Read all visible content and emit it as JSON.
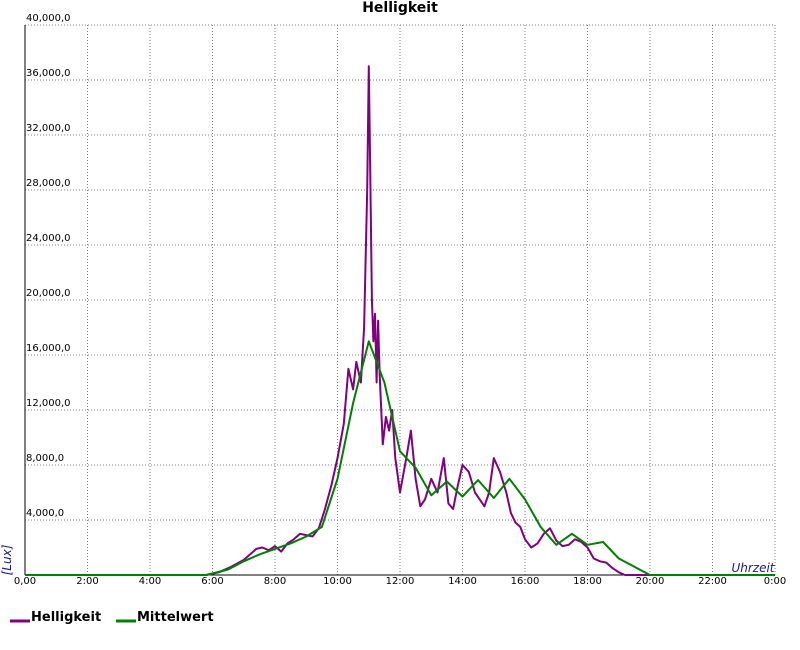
{
  "chart_data": {
    "type": "line",
    "title": "Helligkeit",
    "xlabel": "Uhrzeit",
    "ylabel": "[Lux]",
    "xlim": [
      0,
      24
    ],
    "ylim": [
      0,
      40000
    ],
    "x_ticks": [
      "0,00",
      "2:00",
      "4:00",
      "6:00",
      "8:00",
      "10:00",
      "12:00",
      "14:00",
      "16:00",
      "18:00",
      "20:00",
      "22:00",
      "0:00"
    ],
    "y_ticks": [
      "4,000,0",
      "8,000,0",
      "12,000,0",
      "16,000,0",
      "20,000,0",
      "24,000,0",
      "28,000,0",
      "32,000,0",
      "36,000,0",
      "40,000,0"
    ],
    "grid": true,
    "legend_position": "bottom-left",
    "colors": {
      "Helligkeit": "#800080",
      "Mittelwert": "#008000"
    },
    "series": [
      {
        "name": "Helligkeit",
        "x": [
          0,
          5.8,
          6.2,
          6.6,
          7.0,
          7.4,
          7.6,
          7.8,
          8.0,
          8.2,
          8.4,
          8.6,
          8.8,
          9.0,
          9.2,
          9.4,
          9.6,
          9.8,
          10.0,
          10.2,
          10.35,
          10.5,
          10.6,
          10.75,
          10.85,
          10.95,
          11.0,
          11.05,
          11.1,
          11.15,
          11.2,
          11.25,
          11.3,
          11.35,
          11.45,
          11.55,
          11.65,
          11.75,
          11.85,
          12.0,
          12.2,
          12.35,
          12.5,
          12.65,
          12.8,
          13.0,
          13.2,
          13.4,
          13.55,
          13.7,
          13.85,
          14.0,
          14.2,
          14.4,
          14.55,
          14.7,
          14.85,
          15.0,
          15.2,
          15.4,
          15.55,
          15.7,
          15.85,
          16.0,
          16.2,
          16.4,
          16.6,
          16.8,
          17.0,
          17.2,
          17.4,
          17.6,
          17.8,
          18.0,
          18.2,
          18.4,
          18.6,
          18.8,
          19.0,
          19.2,
          19.4,
          19.7,
          20.0,
          24.0
        ],
        "y": [
          0,
          0,
          200,
          600,
          1100,
          1900,
          2000,
          1800,
          2100,
          1700,
          2300,
          2600,
          3000,
          2900,
          2800,
          3400,
          4800,
          6500,
          8500,
          11000,
          15000,
          13500,
          15500,
          14000,
          18000,
          28000,
          37000,
          29000,
          20000,
          17000,
          19000,
          14000,
          18500,
          14500,
          9500,
          11500,
          10500,
          12000,
          8500,
          6000,
          8500,
          10500,
          7000,
          5000,
          5500,
          7000,
          6000,
          8500,
          5200,
          4800,
          6500,
          8000,
          7500,
          6000,
          5500,
          5000,
          6000,
          8500,
          7500,
          6000,
          4500,
          3800,
          3500,
          2600,
          2000,
          2300,
          3000,
          3400,
          2500,
          2100,
          2200,
          2600,
          2400,
          2000,
          1200,
          1000,
          900,
          500,
          200,
          0,
          0,
          0,
          0,
          0
        ]
      },
      {
        "name": "Mittelwert",
        "x": [
          0,
          5.8,
          6.5,
          7.0,
          7.5,
          8.0,
          8.5,
          9.0,
          9.5,
          10.0,
          10.5,
          11.0,
          11.5,
          12.0,
          12.5,
          13.0,
          13.5,
          14.0,
          14.5,
          15.0,
          15.5,
          16.0,
          16.5,
          17.0,
          17.5,
          18.0,
          18.5,
          19.0,
          19.5,
          20.0,
          24.0
        ],
        "y": [
          0,
          0,
          400,
          1000,
          1500,
          1900,
          2300,
          2800,
          3500,
          7000,
          12500,
          17000,
          14000,
          9000,
          7800,
          5800,
          6800,
          5700,
          6900,
          5600,
          7000,
          5500,
          3500,
          2200,
          3000,
          2200,
          2400,
          1200,
          600,
          0,
          0
        ]
      }
    ]
  }
}
